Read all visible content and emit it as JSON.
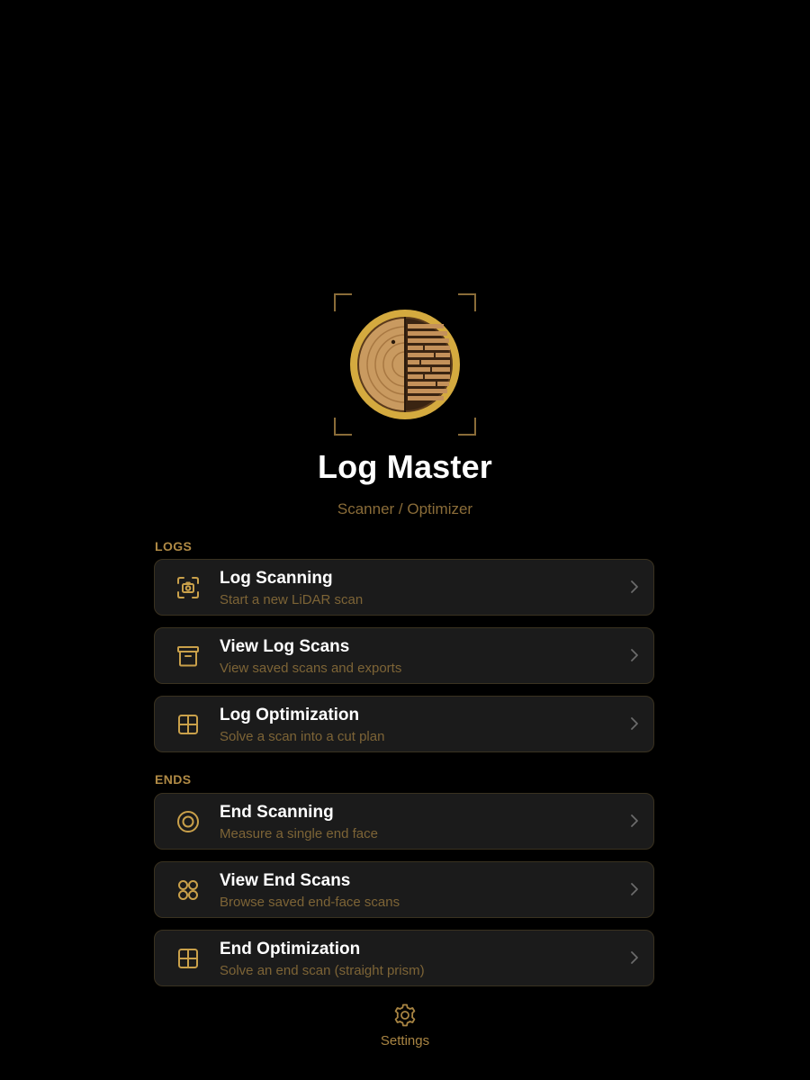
{
  "app": {
    "title": "Log Master",
    "subtitle": "Scanner / Optimizer"
  },
  "colors": {
    "accent": "#c9a04a",
    "card_bg": "#1b1b1b",
    "muted_text": "#7d6436",
    "background": "#000000"
  },
  "sections": {
    "logs": {
      "label": "LOGS",
      "items": [
        {
          "title": "Log Scanning",
          "subtitle": "Start a new LiDAR scan",
          "icon": "camera-scan-icon"
        },
        {
          "title": "View Log Scans",
          "subtitle": "View saved scans and exports",
          "icon": "archive-box-icon"
        },
        {
          "title": "Log Optimization",
          "subtitle": "Solve a scan into a cut plan",
          "icon": "grid-icon"
        }
      ]
    },
    "ends": {
      "label": "ENDS",
      "items": [
        {
          "title": "End Scanning",
          "subtitle": "Measure a single end face",
          "icon": "target-circle-icon"
        },
        {
          "title": "View End Scans",
          "subtitle": "Browse saved end-face scans",
          "icon": "four-circles-icon"
        },
        {
          "title": "End Optimization",
          "subtitle": "Solve an end scan (straight prism)",
          "icon": "grid-icon"
        }
      ]
    }
  },
  "settings": {
    "label": "Settings",
    "icon": "gear-icon"
  }
}
